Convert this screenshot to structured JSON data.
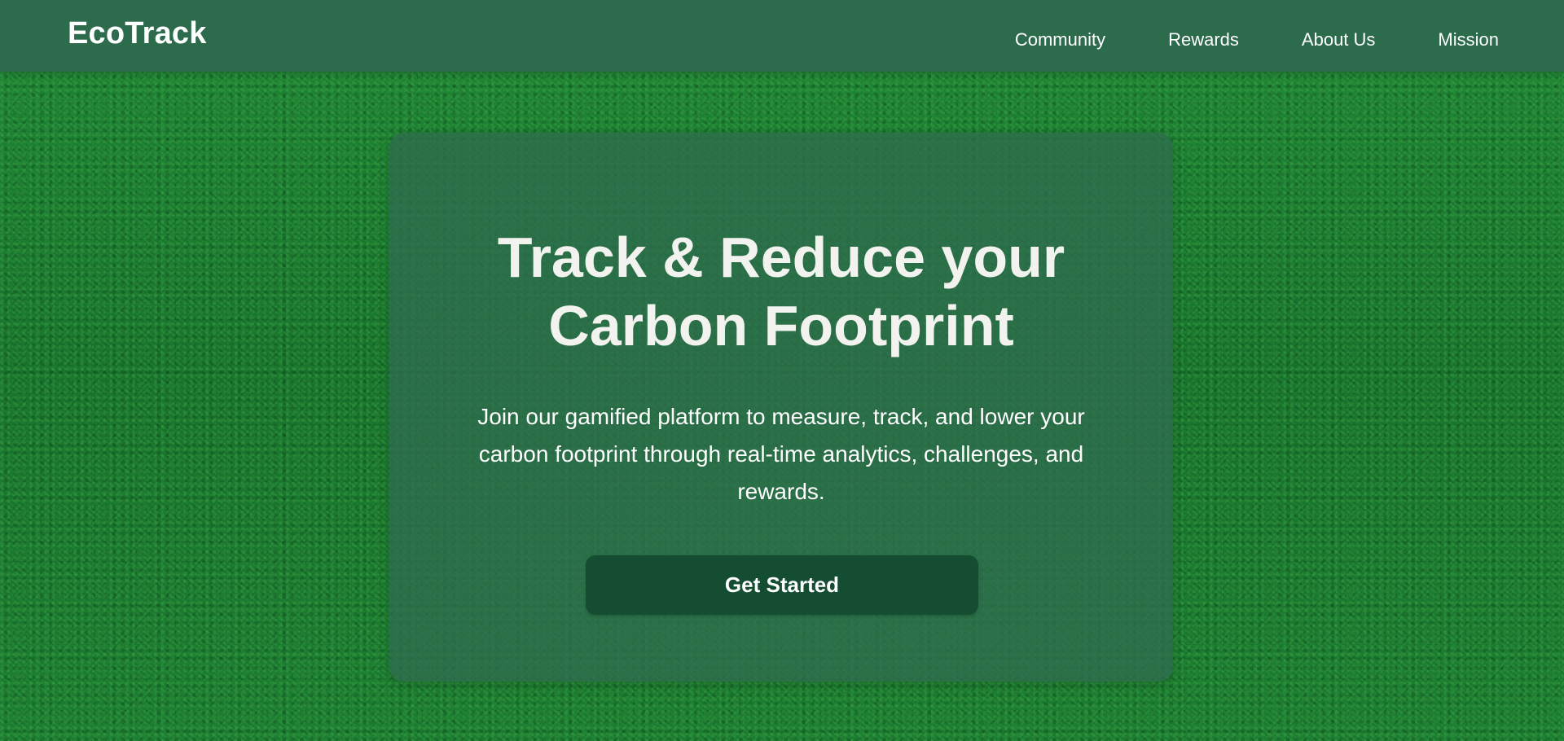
{
  "header": {
    "logo": "EcoTrack",
    "nav": [
      {
        "label": "Community"
      },
      {
        "label": "Rewards"
      },
      {
        "label": "About Us"
      },
      {
        "label": "Mission"
      }
    ]
  },
  "hero": {
    "title_line1": "Track & Reduce your",
    "title_line2": "Carbon Footprint",
    "subtitle": "Join our gamified platform to measure, track, and lower your carbon footprint through real-time analytics, challenges, and rewards.",
    "cta_label": "Get Started"
  },
  "colors": {
    "navbar": "#2d6b4d",
    "card": "#2e6c4e",
    "button": "#144d32",
    "background": "#1a7a2e"
  }
}
